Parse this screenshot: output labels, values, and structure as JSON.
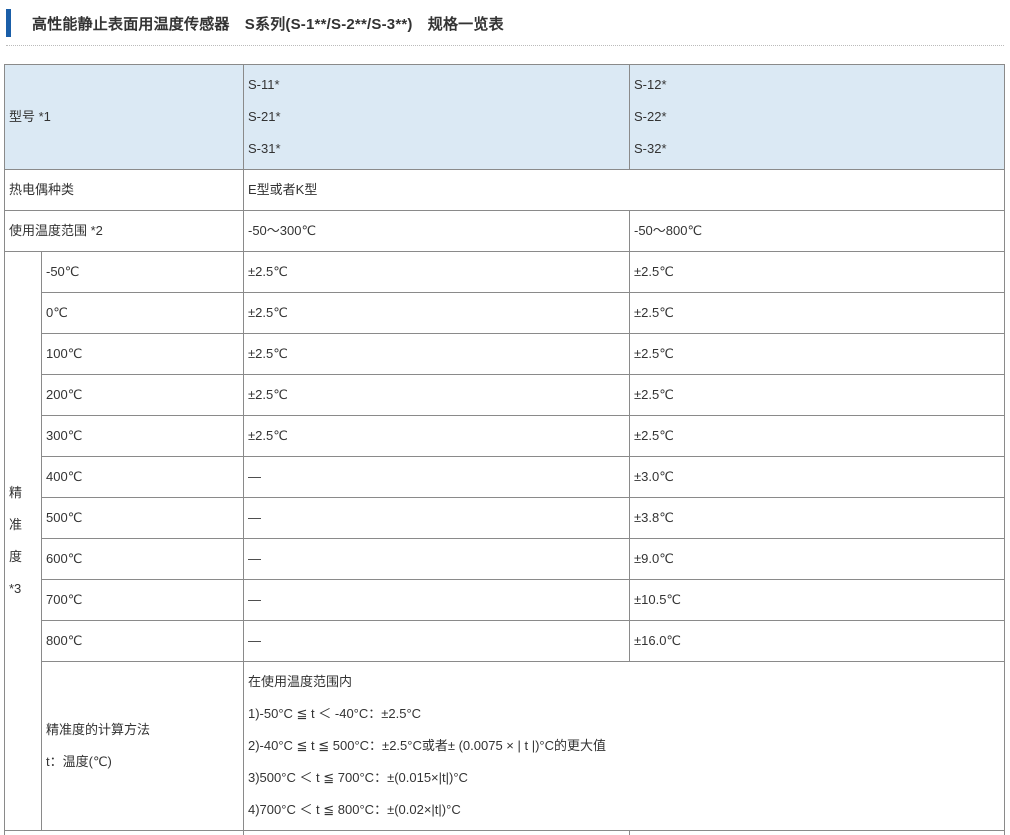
{
  "heading": {
    "title": "高性能静止表面用温度传感器　S系列(S-1**/S-2**/S-3**)　规格一览表"
  },
  "colors": {
    "accent_bar": "#1a5ea8",
    "header_bg": "#dbe9f4",
    "border": "#8a8a8a"
  },
  "table": {
    "model_label": "型号 *1",
    "model_col1": [
      "S-11*",
      "S-21*",
      "S-31*"
    ],
    "model_col2": [
      "S-12*",
      "S-22*",
      "S-32*"
    ],
    "thermocouple_label": "热电偶种类",
    "thermocouple_value": "E型或者K型",
    "range_label": "使用温度范围 *2",
    "range_col1": "-50～300℃",
    "range_col2": "-50～800℃",
    "accuracy_label": [
      "精",
      "准",
      "度",
      "*3"
    ],
    "accuracy_rows": [
      {
        "temp": "-50℃",
        "col1": "±2.5℃",
        "col2": "±2.5℃"
      },
      {
        "temp": "0℃",
        "col1": "±2.5℃",
        "col2": "±2.5℃"
      },
      {
        "temp": "100℃",
        "col1": "±2.5℃",
        "col2": "±2.5℃"
      },
      {
        "temp": "200℃",
        "col1": "±2.5℃",
        "col2": "±2.5℃"
      },
      {
        "temp": "300℃",
        "col1": "±2.5℃",
        "col2": "±2.5℃"
      },
      {
        "temp": "400℃",
        "col1": "—",
        "col2": "±3.0℃"
      },
      {
        "temp": "500℃",
        "col1": "—",
        "col2": "±3.8℃"
      },
      {
        "temp": "600℃",
        "col1": "—",
        "col2": "±9.0℃"
      },
      {
        "temp": "700℃",
        "col1": "—",
        "col2": "±10.5℃"
      },
      {
        "temp": "800℃",
        "col1": "—",
        "col2": "±16.0℃"
      }
    ],
    "calc_label": [
      "精准度的计算方法",
      "t：温度(℃)"
    ],
    "calc_lines": [
      "在使用温度范围内",
      "1)-50°C ≦ t ＜ -40°C：±2.5°C",
      "2)-40°C ≦ t ≦ 500°C：±2.5°C或者± (0.0075 × | t |)°C的更大值",
      "3)500°C ＜ t ≦ 700°C：±(0.015×|t|)°C",
      "4)700°C ＜ t ≦ 800°C：±(0.02×|t|)°C"
    ]
  }
}
